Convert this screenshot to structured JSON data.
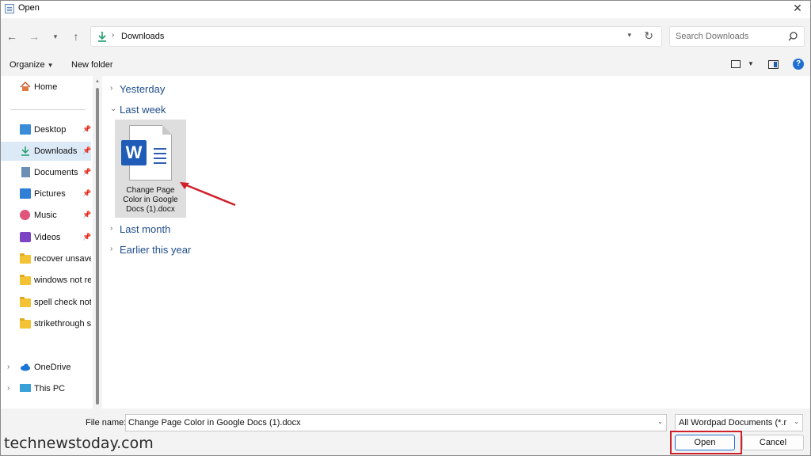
{
  "window": {
    "title": "Open",
    "close_glyph": "✕"
  },
  "nav": {
    "back_icon": "arrow-left-icon",
    "forward_icon": "arrow-right-icon",
    "recent_icon": "chevron-down-icon",
    "up_icon": "arrow-up-icon",
    "address": "Downloads",
    "search_placeholder": "Search Downloads"
  },
  "toolbar": {
    "organize_label": "Organize",
    "new_folder_label": "New folder"
  },
  "sidebar": {
    "home": "Home",
    "items": [
      {
        "label": "Desktop",
        "icon": "desktop-icon",
        "pinned": true
      },
      {
        "label": "Downloads",
        "icon": "download-icon",
        "pinned": true,
        "selected": true
      },
      {
        "label": "Documents",
        "icon": "documents-icon",
        "pinned": true
      },
      {
        "label": "Pictures",
        "icon": "pictures-icon",
        "pinned": true
      },
      {
        "label": "Music",
        "icon": "music-icon",
        "pinned": true
      },
      {
        "label": "Videos",
        "icon": "videos-icon",
        "pinned": true
      },
      {
        "label": "recover unsaved",
        "icon": "folder-icon"
      },
      {
        "label": "windows not res",
        "icon": "folder-icon"
      },
      {
        "label": "spell check not v",
        "icon": "folder-icon"
      },
      {
        "label": "strikethrough sh",
        "icon": "folder-icon"
      }
    ],
    "onedrive": "OneDrive",
    "thispc": "This PC"
  },
  "content": {
    "groups": [
      {
        "label": "Yesterday",
        "expanded": false
      },
      {
        "label": "Last week",
        "expanded": true
      },
      {
        "label": "Last month",
        "expanded": false
      },
      {
        "label": "Earlier this year",
        "expanded": false
      }
    ],
    "file": {
      "name_line1": "Change Page",
      "name_line2": "Color in Google",
      "name_line3": "Docs (1).docx",
      "icon_letter": "W"
    }
  },
  "bottom": {
    "file_name_label": "File name:",
    "file_name_value": "Change Page Color in Google Docs (1).docx",
    "file_type": "All Wordpad Documents (*.rtf, *",
    "open_label": "Open",
    "cancel_label": "Cancel"
  },
  "watermark": "technewstoday.com",
  "colors": {
    "accent": "#1f6fd1",
    "highlight_red": "#d0202a",
    "group_blue": "#1f4e8c",
    "word_blue": "#1e5cb8"
  }
}
